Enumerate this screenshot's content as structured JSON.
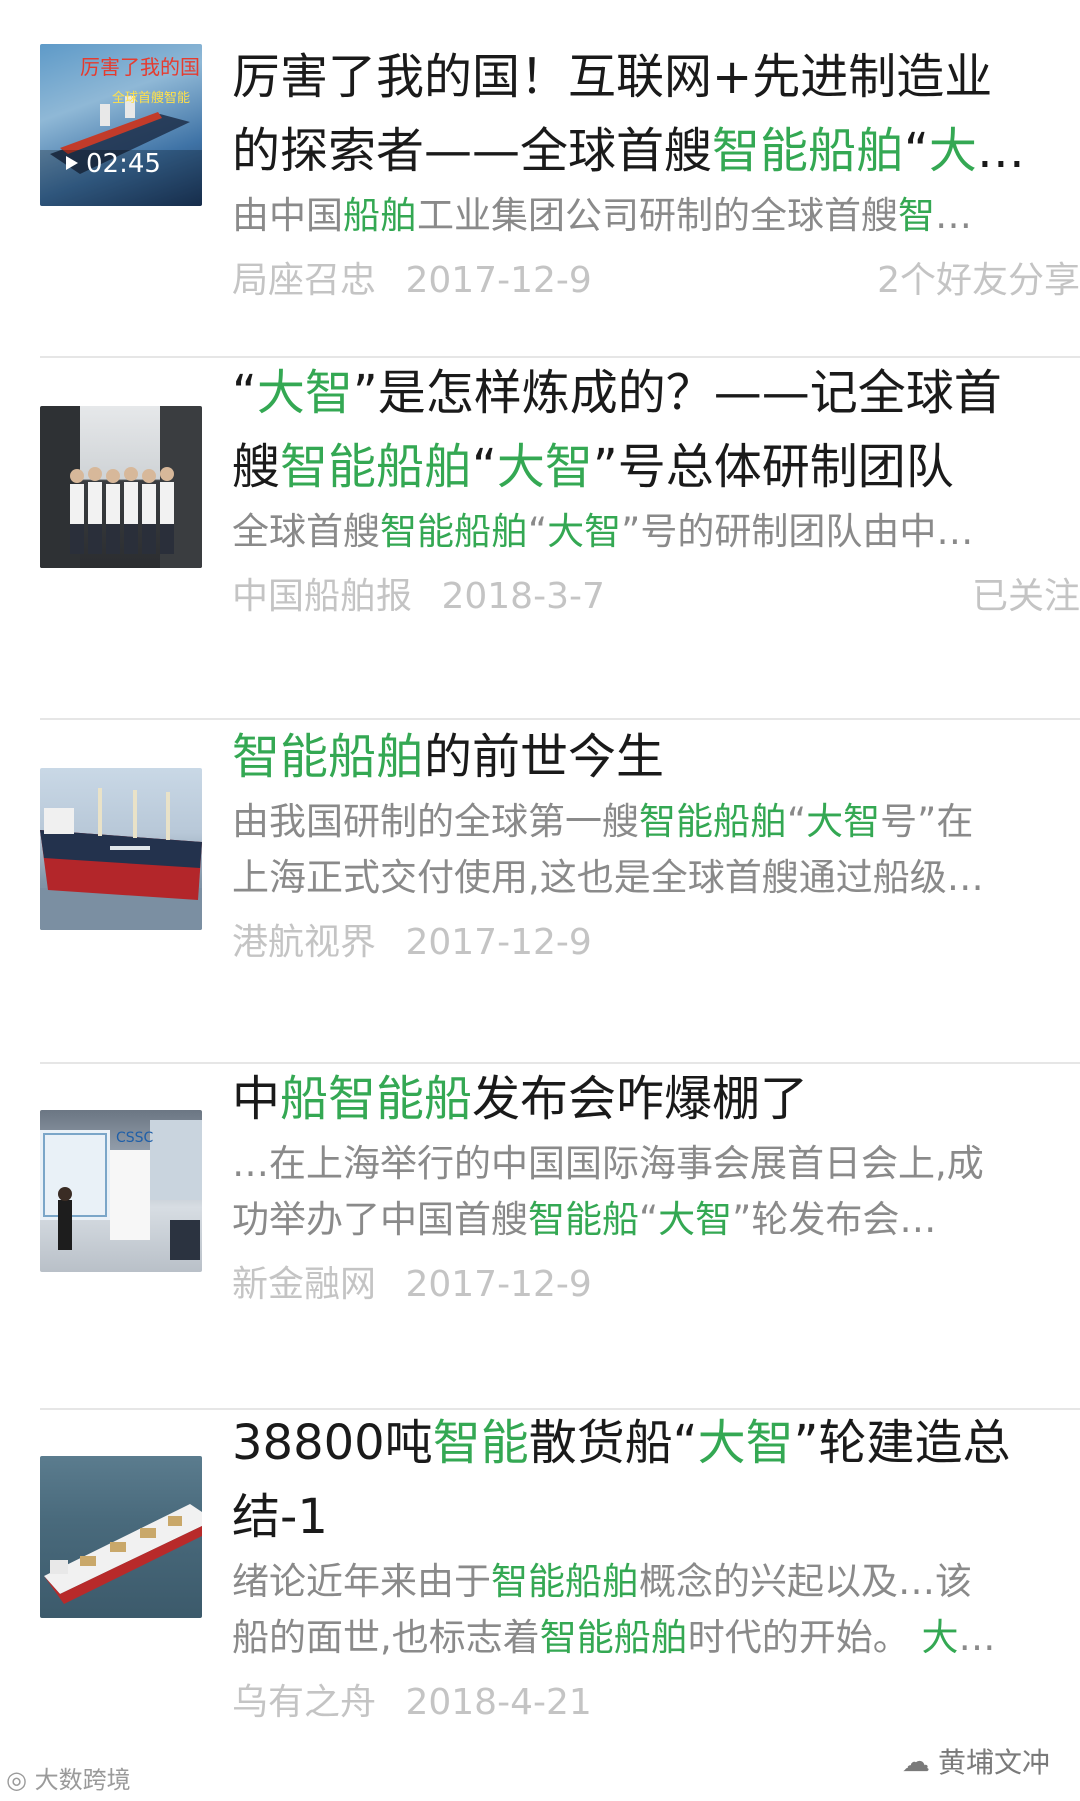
{
  "results": [
    {
      "title_line1": "厉害了我的国！互联网+先进制造业",
      "title_line2_a": "的探索者——全球首艘",
      "title_line2_hl": "智能船舶",
      "title_line2_b": "“",
      "title_line2_hl2": "大",
      "title_line2_c": "…",
      "snippet_a": "由中国",
      "snippet_hl": "船舶",
      "snippet_b": "工业集团公司研制的全球首艘",
      "snippet_hl2": "智",
      "snippet_c": "…",
      "source": "局座召忠",
      "date": "2017-12-9",
      "right_meta": "2个好友分享",
      "video_duration": "02:45",
      "thumb_text_a": "厉害了我的国",
      "thumb_text_b": "全球首艘智能"
    },
    {
      "title_line1_a": "“",
      "title_line1_hl": "大智",
      "title_line1_b": "”是怎样炼成的？——记全球首",
      "title_line2_a": "艘",
      "title_line2_hl": "智能船舶",
      "title_line2_b": "“",
      "title_line2_hl2": "大智",
      "title_line2_c": "”号总体研制团队",
      "snippet_a": "全球首艘",
      "snippet_hl": "智能船舶",
      "snippet_b": "“",
      "snippet_hl2": "大智",
      "snippet_c": "”号的研制团队由中…",
      "source": "中国船舶报",
      "date": "2018-3-7",
      "right_meta": "已关注"
    },
    {
      "title_hl": "智能船舶",
      "title_rest": "的前世今生",
      "snippet1_a": "由我国研制的全球第一艘",
      "snippet1_hl": "智能船舶",
      "snippet1_b": "“",
      "snippet1_hl2": "大智",
      "snippet1_c": "号”在",
      "snippet2": "上海正式交付使用,这也是全球首艘通过船级…",
      "source": "港航视界",
      "date": "2017-12-9"
    },
    {
      "title_a": "中",
      "title_hl": "船智能船",
      "title_b": "发布会咋爆棚了",
      "snippet1": "…在上海举行的中国国际海事会展首日会上,成",
      "snippet2_a": "功举办了中国首艘",
      "snippet2_hl": "智能船",
      "snippet2_b": "“",
      "snippet2_hl2": "大智",
      "snippet2_c": "”轮发布会…",
      "source": "新金融网",
      "date": "2017-12-9"
    },
    {
      "title_line1_a": "38800吨",
      "title_line1_hl": "智能",
      "title_line1_b": "散货船“",
      "title_line1_hl2": "大智",
      "title_line1_c": "”轮建造总",
      "title_line2": "结-1",
      "snippet1_a": "绪论近年来由于",
      "snippet1_hl": "智能船舶",
      "snippet1_b": "概念的兴起以及…该",
      "snippet2_a": "船的面世,也标志着",
      "snippet2_hl": "智能船舶",
      "snippet2_b": "时代的开始。 ",
      "snippet2_hl2": "大",
      "snippet2_c": "…",
      "source": "乌有之舟",
      "date": "2018-4-21"
    }
  ],
  "watermark_left": "大数跨境",
  "watermark_right": "黄埔文冲",
  "colors": {
    "highlight": "#34a853",
    "title": "#1a1a1a",
    "snippet": "#8a8a8a",
    "meta": "#c4c4c4"
  }
}
